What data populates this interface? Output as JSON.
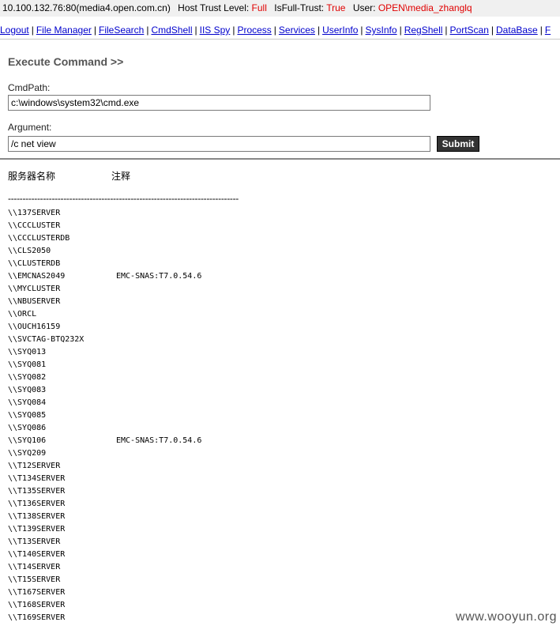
{
  "info_bar": {
    "host": "10.100.132.76:80(media4.open.com.cn)",
    "trust_label": "Host Trust Level:",
    "trust_value": "Full",
    "full_trust_label": "IsFull-Trust:",
    "full_trust_value": "True",
    "user_label": "User:",
    "user_value": "OPEN\\media_zhanglq"
  },
  "nav": {
    "items": [
      "Logout",
      "File Manager",
      "FileSearch",
      "CmdShell",
      "IIS Spy",
      "Process",
      "Services",
      "UserInfo",
      "SysInfo",
      "RegShell",
      "PortScan",
      "DataBase",
      "F"
    ],
    "separator": "|"
  },
  "section_title": "Execute Command >>",
  "cmdpath": {
    "label": "CmdPath:",
    "value": "c:\\windows\\system32\\cmd.exe"
  },
  "argument": {
    "label": "Argument:",
    "value": "/c net view"
  },
  "submit_label": "Submit",
  "output": {
    "col1_header": "服务器名称",
    "col2_header": "注释",
    "divider": "-------------------------------------------------------------------------------",
    "rows": [
      {
        "name": "\\\\137SERVER",
        "comment": ""
      },
      {
        "name": "\\\\CCCLUSTER",
        "comment": ""
      },
      {
        "name": "\\\\CCCLUSTERDB",
        "comment": ""
      },
      {
        "name": "\\\\CLS2050",
        "comment": ""
      },
      {
        "name": "\\\\CLUSTERDB",
        "comment": ""
      },
      {
        "name": "\\\\EMCNAS2049",
        "comment": "EMC-SNAS:T7.0.54.6"
      },
      {
        "name": "\\\\MYCLUSTER",
        "comment": ""
      },
      {
        "name": "\\\\NBUSERVER",
        "comment": ""
      },
      {
        "name": "\\\\ORCL",
        "comment": ""
      },
      {
        "name": "\\\\OUCH16159",
        "comment": ""
      },
      {
        "name": "\\\\SVCTAG-BTQ232X",
        "comment": ""
      },
      {
        "name": "\\\\SYQ013",
        "comment": ""
      },
      {
        "name": "\\\\SYQ081",
        "comment": ""
      },
      {
        "name": "\\\\SYQ082",
        "comment": ""
      },
      {
        "name": "\\\\SYQ083",
        "comment": ""
      },
      {
        "name": "\\\\SYQ084",
        "comment": ""
      },
      {
        "name": "\\\\SYQ085",
        "comment": ""
      },
      {
        "name": "\\\\SYQ086",
        "comment": ""
      },
      {
        "name": "\\\\SYQ106",
        "comment": "EMC-SNAS:T7.0.54.6"
      },
      {
        "name": "\\\\SYQ209",
        "comment": ""
      },
      {
        "name": "\\\\T12SERVER",
        "comment": ""
      },
      {
        "name": "\\\\T134SERVER",
        "comment": ""
      },
      {
        "name": "\\\\T135SERVER",
        "comment": ""
      },
      {
        "name": "\\\\T136SERVER",
        "comment": ""
      },
      {
        "name": "\\\\T138SERVER",
        "comment": ""
      },
      {
        "name": "\\\\T139SERVER",
        "comment": ""
      },
      {
        "name": "\\\\T13SERVER",
        "comment": ""
      },
      {
        "name": "\\\\T140SERVER",
        "comment": ""
      },
      {
        "name": "\\\\T14SERVER",
        "comment": ""
      },
      {
        "name": "\\\\T15SERVER",
        "comment": ""
      },
      {
        "name": "\\\\T167SERVER",
        "comment": ""
      },
      {
        "name": "\\\\T168SERVER",
        "comment": ""
      },
      {
        "name": "\\\\T169SERVER",
        "comment": ""
      }
    ]
  },
  "watermark": "www.wooyun.org",
  "colors": {
    "link": "#0000cc",
    "highlight_red": "#e00000",
    "submit_bg": "#333333"
  }
}
